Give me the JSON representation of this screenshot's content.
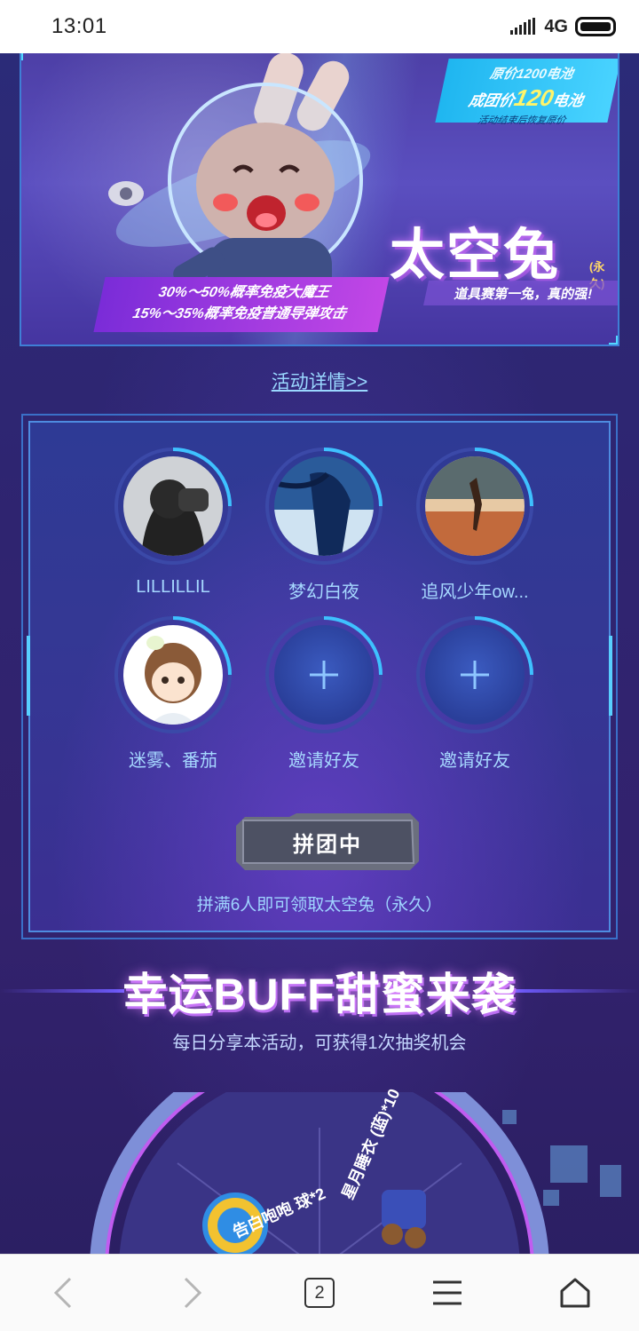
{
  "status_bar": {
    "time": "13:01",
    "network": "4G",
    "signal_icon": "signal-icon",
    "battery_icon": "battery-icon"
  },
  "banner": {
    "price_original": "原价1200电池",
    "price_group_prefix": "成团价",
    "price_group_value": "120",
    "price_group_suffix": "电池",
    "price_note": "活动结束后恢复原价",
    "product_name": "太空兔",
    "product_duration": "(永久)",
    "product_slogan": "道具赛第一兔，真的强!",
    "odds_line1": "30%～50%概率免疫大魔王",
    "odds_line2": "15%～35%概率免疫普通导弹攻击"
  },
  "details_link": "活动详情>>",
  "group": {
    "members": [
      {
        "name": "LILLILLIL"
      },
      {
        "name": "梦幻白夜"
      },
      {
        "name": "追风少年ow..."
      },
      {
        "name": "迷雾、番茄"
      }
    ],
    "invite_label": "邀请好友",
    "status_button": "拼团中",
    "note": "拼满6人即可领取太空兔（永久）"
  },
  "buff": {
    "title": "幸运BUFF甜蜜来袭",
    "subtitle": "每日分享本活动，可获得1次抽奖机会",
    "prizes": [
      {
        "name": "告白咆咆",
        "suffix": "球*2"
      },
      {
        "name": "星月睡衣",
        "suffix": "(蓝)*10"
      }
    ]
  },
  "bottom_nav": {
    "tab_count": "2",
    "icons": [
      "back-icon",
      "forward-icon",
      "tabs-icon",
      "menu-icon",
      "home-icon"
    ]
  },
  "colors": {
    "accent_cyan": "#52d6ff",
    "link_blue": "#9ad8ff",
    "bg_purple": "#2f2470"
  }
}
